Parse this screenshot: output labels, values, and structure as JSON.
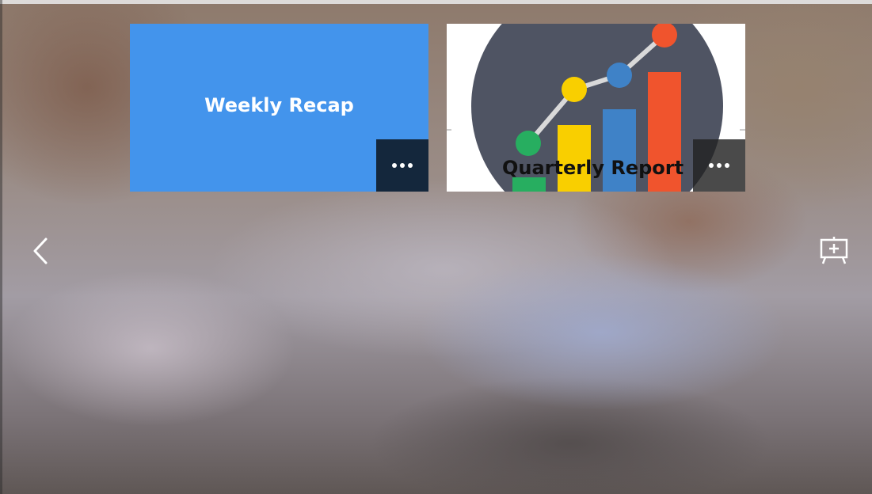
{
  "cards": [
    {
      "title": "Weekly Recap",
      "background": "#4394ec",
      "more_icon": "more-horizontal-icon"
    },
    {
      "title": "Quarterly Report",
      "background": "#ffffff",
      "thumbnail": "bar-and-line-chart-illustration",
      "more_icon": "more-horizontal-icon"
    }
  ],
  "navigation": {
    "back_icon": "chevron-left-icon",
    "add_icon": "add-to-presentation-icon"
  },
  "colors": {
    "chart_circle": "#4f5463",
    "bar_green": "#27ae60",
    "bar_yellow": "#f9cf00",
    "bar_blue": "#3f82c7",
    "bar_orange": "#f0542d",
    "line": "#d9d9d9"
  }
}
